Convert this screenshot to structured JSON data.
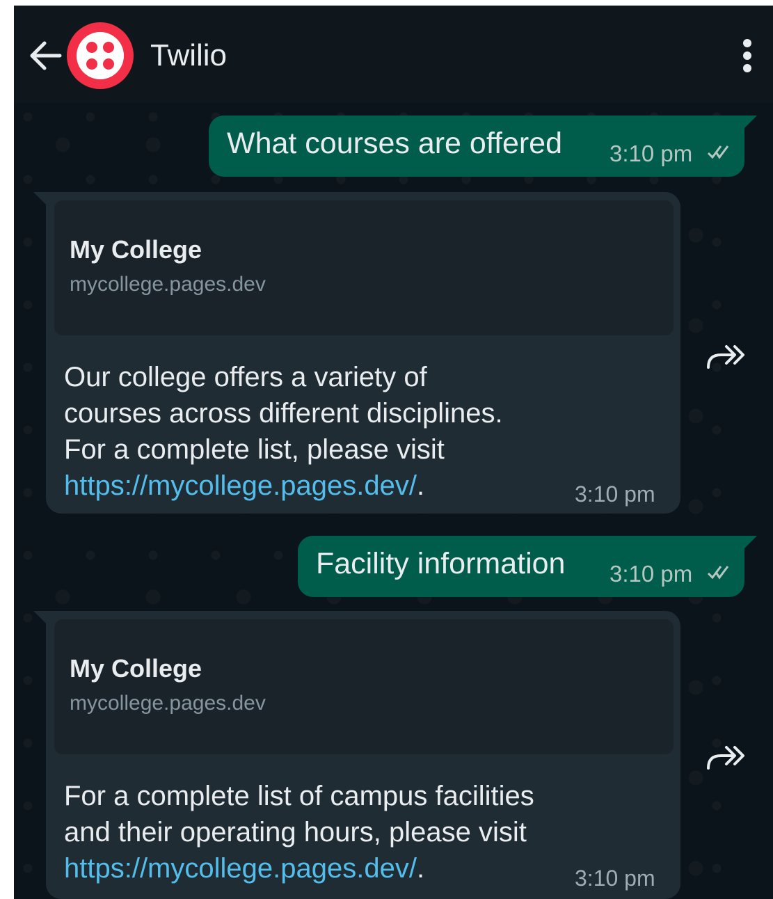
{
  "header": {
    "contact_name": "Twilio",
    "back_icon": "arrow-left-icon",
    "avatar_icon": "twilio-logo-icon",
    "menu_icon": "more-vertical-icon"
  },
  "messages": [
    {
      "direction": "outgoing",
      "text": "What courses are offered",
      "time": "3:10 pm",
      "status": "read"
    },
    {
      "direction": "incoming",
      "preview_title": "My College",
      "preview_domain": "mycollege.pages.dev",
      "lines": [
        "Our college offers a variety of",
        "courses across different disciplines.",
        "For a complete list, please visit"
      ],
      "link": "https://mycollege.pages.dev/",
      "link_suffix": ".",
      "time": "3:10 pm"
    },
    {
      "direction": "outgoing",
      "text": "Facility information",
      "time": "3:10 pm",
      "status": "read"
    },
    {
      "direction": "incoming",
      "preview_title": "My College",
      "preview_domain": "mycollege.pages.dev",
      "lines": [
        "For a complete list of campus facilities",
        "and their operating hours, please visit"
      ],
      "link": "https://mycollege.pages.dev/",
      "link_suffix": ".",
      "time": "3:10 pm"
    }
  ],
  "colors": {
    "outgoing_bubble": "#005c4b",
    "incoming_bubble": "#202c33",
    "link": "#53bdeb",
    "avatar": "#f22f46"
  }
}
